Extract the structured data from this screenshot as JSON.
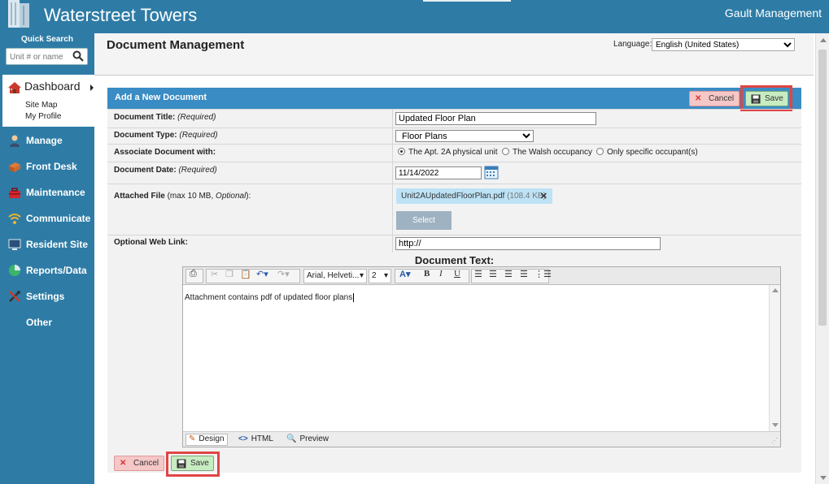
{
  "app": {
    "title": "Waterstreet Towers",
    "company": "Gault Management"
  },
  "sidebar": {
    "quick_search_label": "Quick Search",
    "quick_search_placeholder": "Unit # or name",
    "dashboard": {
      "label": "Dashboard",
      "sub": [
        "Site Map",
        "My Profile"
      ]
    },
    "items": [
      {
        "label": "Manage",
        "icon": "person-icon"
      },
      {
        "label": "Front Desk",
        "icon": "package-icon"
      },
      {
        "label": "Maintenance",
        "icon": "toolbox-icon"
      },
      {
        "label": "Communicate",
        "icon": "wifi-icon"
      },
      {
        "label": "Resident Site",
        "icon": "monitor-icon"
      },
      {
        "label": "Reports/Data",
        "icon": "pie-chart-icon"
      },
      {
        "label": "Settings",
        "icon": "tools-icon"
      },
      {
        "label": "Other",
        "icon": ""
      }
    ]
  },
  "page": {
    "title": "Document Management",
    "language_label": "Language:",
    "language_value": "English (United States)"
  },
  "form": {
    "header": "Add a New Document",
    "cancel_label": "Cancel",
    "save_label": "Save",
    "title_label": "Document Title:",
    "title_req": "(Required)",
    "title_value": "Updated Floor Plan",
    "type_label": "Document Type:",
    "type_req": "(Required)",
    "type_value": "Floor Plans",
    "assoc_label": "Associate Document with:",
    "assoc_options": [
      "The Apt. 2A physical unit",
      "The Walsh occupancy",
      "Only specific occupant(s)"
    ],
    "date_label": "Document Date:",
    "date_req": "(Required)",
    "date_value": "11/14/2022",
    "file_label": "Attached File",
    "file_note_pre": "(max 10 MB,",
    "file_note_opt": "Optional",
    "file_note_post": "):",
    "file_name": "Unit2AUpdatedFloorPlan.pdf",
    "file_size": "(108.4 KB)",
    "select_label": "Select",
    "link_label": "Optional Web Link:",
    "link_value": "http://",
    "doc_text_label": "Document Text:"
  },
  "editor": {
    "font_value": "Arial, Helveti...",
    "size_value": "2",
    "content": "Attachment contains pdf of updated floor plans",
    "modes": [
      "Design",
      "HTML",
      "Preview"
    ]
  },
  "colors": {
    "brand": "#2e7ca6",
    "form_header": "#3a8cc4",
    "highlight": "#e04545",
    "save_bg": "#c8ecc2",
    "cancel_bg": "#f6c7c7"
  }
}
